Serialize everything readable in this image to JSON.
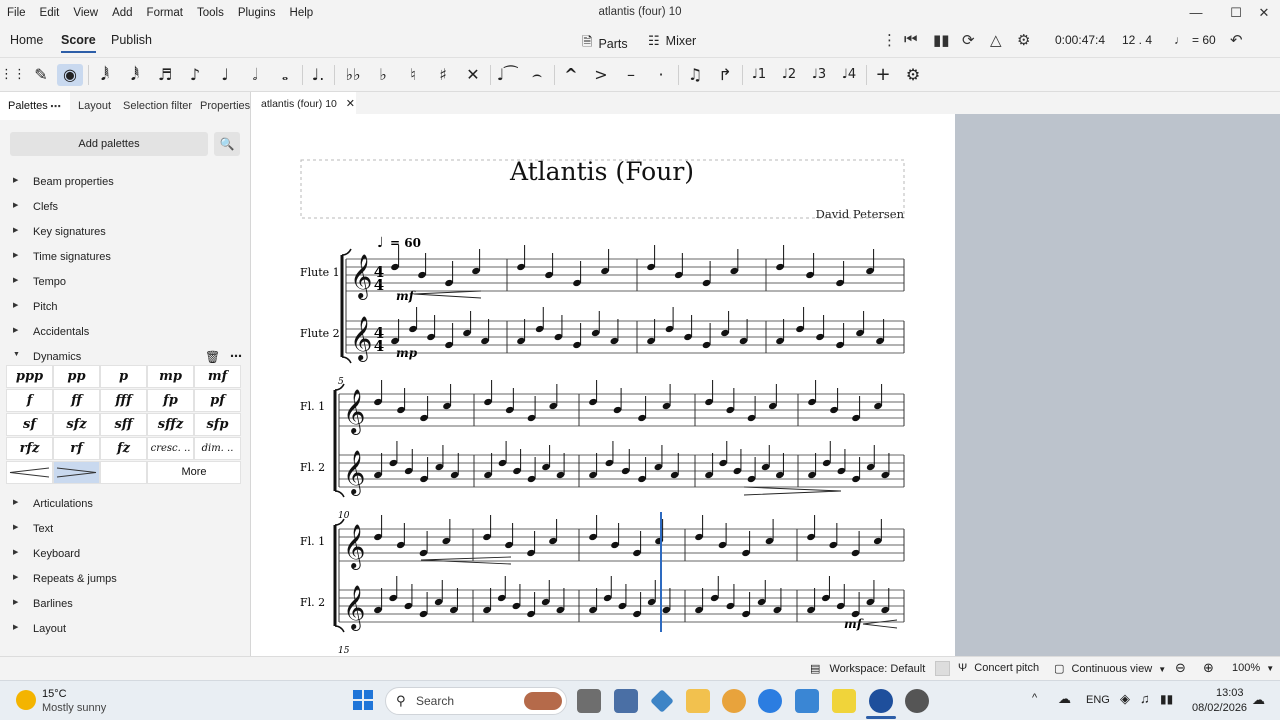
{
  "window": {
    "title": "atlantis (four) 10"
  },
  "menu": [
    "File",
    "Edit",
    "View",
    "Add",
    "Format",
    "Tools",
    "Plugins",
    "Help"
  ],
  "tabs": {
    "home": "Home",
    "score": "Score",
    "publish": "Publish"
  },
  "toolbar_top": {
    "parts": "Parts",
    "mixer": "Mixer",
    "time": "0:00:47:4",
    "position": "12 . 4",
    "tempo": "= 60"
  },
  "panel": {
    "tabs": {
      "palettes": "Palettes",
      "layout": "Layout",
      "selection_filter": "Selection filter",
      "properties": "Properties"
    },
    "add_palettes": "Add palettes",
    "items_top": [
      "Beam properties",
      "Clefs",
      "Key signatures",
      "Time signatures",
      "Tempo",
      "Pitch",
      "Accidentals"
    ],
    "dynamics": {
      "label": "Dynamics",
      "cells": [
        "ppp",
        "pp",
        "p",
        "mp",
        "mf",
        "f",
        "ff",
        "fff",
        "fp",
        "pf",
        "sf",
        "sfz",
        "sff",
        "sffz",
        "sfp",
        "rfz",
        "rf",
        "fz",
        "cresc. ..",
        "dim. .."
      ],
      "more": "More"
    },
    "items_bottom": [
      "Articulations",
      "Text",
      "Keyboard",
      "Repeats & jumps",
      "Barlines",
      "Layout"
    ]
  },
  "document_tab": "atlantis (four) 10",
  "score": {
    "title": "Atlantis (Four)",
    "composer": "David Petersen",
    "tempo_mark": "= 60",
    "time_signature": [
      "4",
      "4"
    ],
    "instruments_full": [
      "Flute 1",
      "Flute 2"
    ],
    "instruments_short": [
      "Fl. 1",
      "Fl. 2"
    ],
    "measure_numbers": [
      "5",
      "10",
      "15"
    ],
    "dynamics": {
      "flute1": "mf",
      "flute2": "mp",
      "system3": "mf"
    }
  },
  "statusbar": {
    "workspace": "Workspace: Default",
    "concert_pitch": "Concert pitch",
    "view_mode": "Continuous view",
    "zoom": "100%"
  },
  "taskbar": {
    "weather_temp": "15°C",
    "weather_desc": "Mostly sunny",
    "search": "Search",
    "lang": "ENG",
    "time": "13:03",
    "date": "08/02/2026"
  }
}
